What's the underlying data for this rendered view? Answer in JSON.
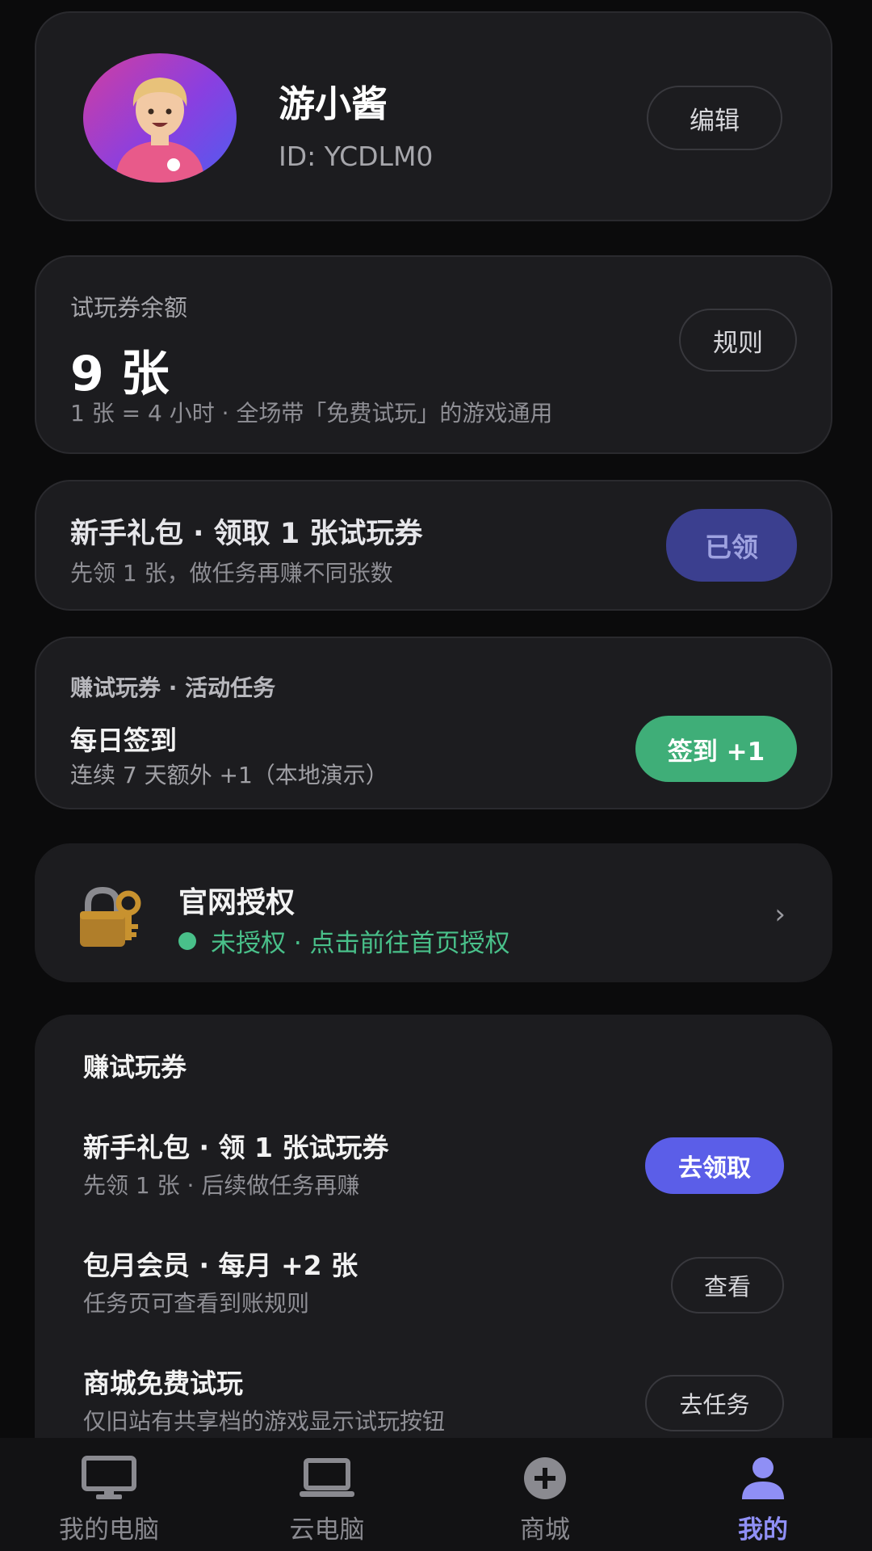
{
  "profile": {
    "name": "游小酱",
    "id_text": "ID: YCDLM0",
    "edit_label": "编辑"
  },
  "balance": {
    "label": "试玩券余额",
    "value": "9 张",
    "note": "1 张 = 4 小时 · 全场带「免费试玩」的游戏通用",
    "rules_label": "规则"
  },
  "novice_gift": {
    "title": "新手礼包 · 领取 1 张试玩券",
    "subtitle": "先领 1 张，做任务再赚不同张数",
    "button_label": "已领"
  },
  "daily_task": {
    "header": "赚试玩券 · 活动任务",
    "title": "每日签到",
    "subtitle": "连续 7 天额外 +1（本地演示）",
    "button_label": "签到 +1"
  },
  "authorization": {
    "title": "官网授权",
    "status": "未授权 · 点击前往首页授权",
    "chevron": "›"
  },
  "earn": {
    "title": "赚试玩券",
    "rows": [
      {
        "title": "新手礼包 · 领 1 张试玩券",
        "subtitle": "先领 1 张 · 后续做任务再赚",
        "button": "去领取"
      },
      {
        "title": "包月会员 · 每月 +2 张",
        "subtitle": "任务页可查看到账规则",
        "button": "查看"
      },
      {
        "title": "商城免费试玩",
        "subtitle": "仅旧站有共享档的游戏显示试玩按钮",
        "button": "去任务"
      }
    ]
  },
  "nav": {
    "items": [
      {
        "label": "我的电脑",
        "icon": "monitor-icon"
      },
      {
        "label": "云电脑",
        "icon": "laptop-icon"
      },
      {
        "label": "商城",
        "icon": "plus-circle-icon"
      },
      {
        "label": "我的",
        "icon": "person-icon"
      }
    ],
    "active_index": 3
  },
  "colors": {
    "background": "#0b0b0c",
    "card": "#1c1c1f",
    "accent_purple": "#5b5ee8",
    "accent_green": "#3fae78",
    "status_green": "#49c08a",
    "nav_active": "#8f8ff5"
  }
}
